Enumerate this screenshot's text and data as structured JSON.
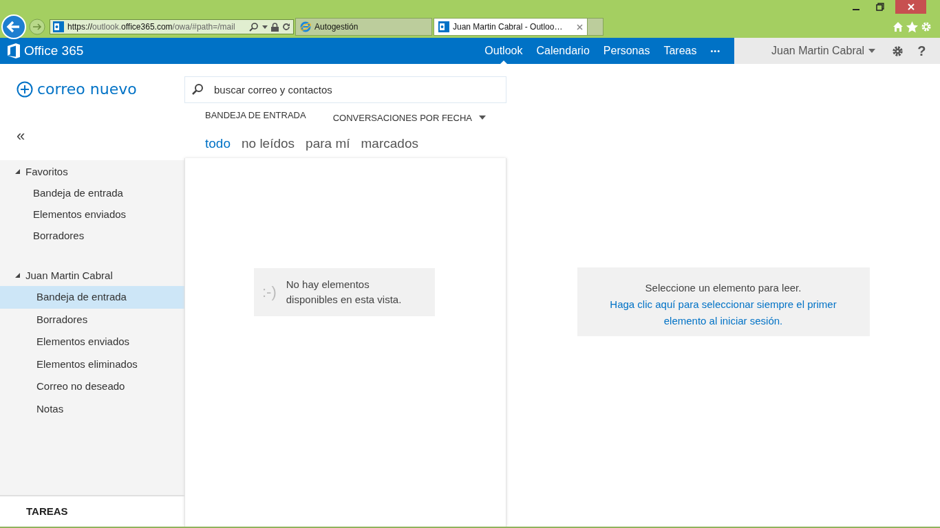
{
  "browser": {
    "address": [
      {
        "text": "https://",
        "strong": true
      },
      {
        "text": "outlook.",
        "strong": false
      },
      {
        "text": "office365.com",
        "strong": true
      },
      {
        "text": "/owa/#path=/mail",
        "strong": false
      }
    ],
    "tabs": [
      {
        "label": "Autogestión",
        "selected": false,
        "kind": "ie"
      },
      {
        "label": "Juan Martin Cabral - Outloo…",
        "selected": true,
        "kind": "outlook"
      }
    ]
  },
  "appbar": {
    "brand": "Office 365",
    "nav": [
      {
        "label": "Outlook",
        "selected": true
      },
      {
        "label": "Calendario",
        "selected": false
      },
      {
        "label": "Personas",
        "selected": false
      },
      {
        "label": "Tareas",
        "selected": false
      }
    ],
    "more": "•••",
    "user": "Juan Martin Cabral",
    "help": "?"
  },
  "new_mail": "correo nuevo",
  "collapse": "«",
  "folders": [
    {
      "label": "Favoritos",
      "expanded": true,
      "children": [
        {
          "label": "Bandeja de entrada",
          "selected": false
        },
        {
          "label": "Elementos enviados",
          "selected": false
        },
        {
          "label": "Borradores",
          "selected": false
        }
      ]
    },
    {
      "label": "Juan Martin Cabral",
      "expanded": true,
      "children": [
        {
          "label": "Bandeja de entrada",
          "selected": true
        },
        {
          "label": "Borradores",
          "selected": false
        },
        {
          "label": "Elementos enviados",
          "selected": false
        },
        {
          "label": "Elementos eliminados",
          "selected": false
        },
        {
          "label": "Correo no deseado",
          "selected": false
        },
        {
          "label": "Notas",
          "selected": false
        }
      ]
    }
  ],
  "tasks": "TAREAS",
  "search": {
    "placeholder": "buscar correo y contactos"
  },
  "list_header": {
    "folder": "BANDEJA DE ENTRADA",
    "sort": "CONVERSACIONES POR FECHA"
  },
  "filters": [
    {
      "label": "todo",
      "selected": true
    },
    {
      "label": "no leídos",
      "selected": false
    },
    {
      "label": "para mí",
      "selected": false
    },
    {
      "label": "marcados",
      "selected": false
    }
  ],
  "empty": {
    "face": ":-)",
    "message": "No hay elementos disponibles en esta vista."
  },
  "reading": {
    "message": "Seleccione un elemento para leer.",
    "link": "Haga clic aquí para seleccionar siempre el primer elemento al iniciar sesión."
  }
}
